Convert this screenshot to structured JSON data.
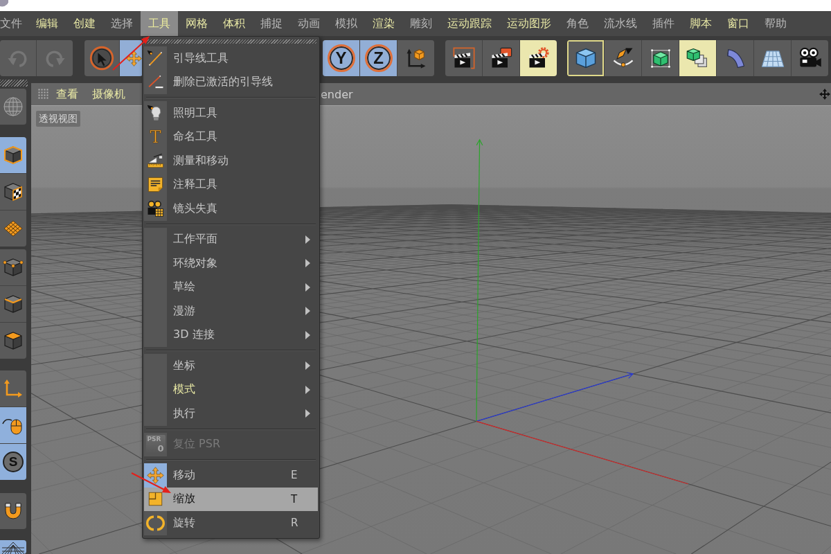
{
  "menu_bar": {
    "items": [
      {
        "label": "文件",
        "highlight": false,
        "selected": false
      },
      {
        "label": "编辑",
        "highlight": true,
        "selected": false
      },
      {
        "label": "创建",
        "highlight": true,
        "selected": false
      },
      {
        "label": "选择",
        "highlight": false,
        "selected": false
      },
      {
        "label": "工具",
        "highlight": true,
        "selected": true
      },
      {
        "label": "网格",
        "highlight": true,
        "selected": false
      },
      {
        "label": "体积",
        "highlight": true,
        "selected": false
      },
      {
        "label": "捕捉",
        "highlight": false,
        "selected": false
      },
      {
        "label": "动画",
        "highlight": false,
        "selected": false
      },
      {
        "label": "模拟",
        "highlight": false,
        "selected": false
      },
      {
        "label": "渲染",
        "highlight": true,
        "selected": false
      },
      {
        "label": "雕刻",
        "highlight": false,
        "selected": false
      },
      {
        "label": "运动跟踪",
        "highlight": true,
        "selected": false
      },
      {
        "label": "运动图形",
        "highlight": true,
        "selected": false
      },
      {
        "label": "角色",
        "highlight": false,
        "selected": false
      },
      {
        "label": "流水线",
        "highlight": false,
        "selected": false
      },
      {
        "label": "插件",
        "highlight": false,
        "selected": false
      },
      {
        "label": "脚本",
        "highlight": true,
        "selected": false
      },
      {
        "label": "窗口",
        "highlight": true,
        "selected": false
      },
      {
        "label": "帮助",
        "highlight": false,
        "selected": false
      }
    ]
  },
  "toolbar": {
    "groups": [
      {
        "buttons": [
          {
            "on": false,
            "hover": false,
            "focus": false,
            "disabled": true
          },
          {
            "on": false,
            "hover": false,
            "focus": false,
            "disabled": true
          }
        ]
      },
      {
        "buttons": [
          {
            "on": false,
            "hover": false,
            "focus": false,
            "disabled": false
          },
          {
            "on": true,
            "hover": false,
            "focus": false,
            "disabled": false
          }
        ]
      },
      {
        "buttons": [
          {
            "label": "Y",
            "on": true,
            "hover": false,
            "focus": false,
            "disabled": false
          },
          {
            "label": "Z",
            "on": true,
            "hover": false,
            "focus": false,
            "disabled": false
          },
          {
            "on": false,
            "hover": false,
            "focus": false,
            "disabled": false
          }
        ]
      },
      {
        "buttons": [
          {
            "on": false,
            "hover": false,
            "focus": false,
            "disabled": false
          },
          {
            "on": false,
            "hover": false,
            "focus": false,
            "disabled": false
          },
          {
            "on": false,
            "hover": true,
            "focus": false,
            "disabled": false
          }
        ]
      },
      {
        "buttons": [
          {
            "on": false,
            "hover": false,
            "focus": true,
            "disabled": false
          },
          {
            "on": false,
            "hover": false,
            "focus": false,
            "disabled": false
          },
          {
            "on": false,
            "hover": false,
            "focus": false,
            "disabled": false
          },
          {
            "on": false,
            "hover": true,
            "focus": false,
            "disabled": false
          },
          {
            "on": false,
            "hover": false,
            "focus": false,
            "disabled": false
          },
          {
            "on": false,
            "hover": false,
            "focus": false,
            "disabled": false
          },
          {
            "on": false,
            "hover": false,
            "focus": false,
            "disabled": false
          }
        ]
      }
    ]
  },
  "left_toolbar": {
    "groups": [
      {
        "buttons": [
          {
            "on": false
          }
        ]
      },
      {
        "buttons": [
          {
            "on": true
          },
          {
            "on": false
          },
          {
            "on": false
          }
        ]
      },
      {
        "buttons": [
          {
            "on": false
          },
          {
            "on": false
          },
          {
            "on": false
          }
        ]
      },
      {
        "buttons": [
          {
            "on": false
          },
          {
            "on": true
          },
          {
            "label": "S",
            "on": true
          }
        ]
      },
      {
        "buttons": [
          {
            "on": false
          }
        ]
      },
      {
        "buttons": [
          {
            "on": true
          }
        ]
      }
    ]
  },
  "viewport": {
    "menu": [
      {
        "label": "查看",
        "highlight": true
      },
      {
        "label": "摄像机",
        "highlight": true
      },
      {
        "label": "ender",
        "highlight": false
      }
    ],
    "view_label": "透视视图"
  },
  "tools_menu": {
    "groups": [
      {
        "items": [
          {
            "label": "引导线工具",
            "kind": "command",
            "selected": false,
            "disabled": false,
            "highlight": false
          },
          {
            "label": "删除已激活的引导线",
            "kind": "command",
            "selected": false,
            "disabled": false,
            "highlight": false
          }
        ]
      },
      {
        "items": [
          {
            "label": "照明工具",
            "kind": "command",
            "selected": false,
            "disabled": false,
            "highlight": false
          },
          {
            "label": "命名工具",
            "kind": "command",
            "glyph": "T",
            "selected": false,
            "disabled": false,
            "highlight": false
          },
          {
            "label": "测量和移动",
            "kind": "command",
            "selected": false,
            "disabled": false,
            "highlight": false
          },
          {
            "label": "注释工具",
            "kind": "command",
            "selected": false,
            "disabled": false,
            "highlight": false
          },
          {
            "label": "镜头失真",
            "kind": "command",
            "selected": false,
            "disabled": false,
            "highlight": false
          }
        ]
      },
      {
        "items": [
          {
            "label": "工作平面",
            "kind": "submenu",
            "selected": false,
            "disabled": false,
            "highlight": false
          },
          {
            "label": "环绕对象",
            "kind": "submenu",
            "selected": false,
            "disabled": false,
            "highlight": false
          },
          {
            "label": "草绘",
            "kind": "submenu",
            "selected": false,
            "disabled": false,
            "highlight": false
          },
          {
            "label": "漫游",
            "kind": "submenu",
            "selected": false,
            "disabled": false,
            "highlight": false
          },
          {
            "label": "3D 连接",
            "kind": "submenu",
            "selected": false,
            "disabled": false,
            "highlight": false
          }
        ]
      },
      {
        "items": [
          {
            "label": "坐标",
            "kind": "submenu",
            "selected": false,
            "disabled": false,
            "highlight": false
          },
          {
            "label": "模式",
            "kind": "submenu",
            "selected": false,
            "disabled": false,
            "highlight": true
          },
          {
            "label": "执行",
            "kind": "submenu",
            "selected": false,
            "disabled": false,
            "highlight": false
          }
        ]
      },
      {
        "items": [
          {
            "label": "复位 PSR",
            "kind": "command",
            "icon_text": "PSR",
            "icon_value": "0",
            "selected": false,
            "disabled": true,
            "highlight": false
          }
        ]
      },
      {
        "items": [
          {
            "label": "移动",
            "kind": "command",
            "shortcut": "E",
            "active": true,
            "selected": false,
            "disabled": false,
            "highlight": false
          },
          {
            "label": "缩放",
            "kind": "command",
            "shortcut": "T",
            "active": false,
            "selected": true,
            "disabled": false,
            "highlight": false
          },
          {
            "label": "旋转",
            "kind": "command",
            "shortcut": "R",
            "active": false,
            "selected": false,
            "disabled": false,
            "highlight": false
          }
        ]
      }
    ]
  }
}
